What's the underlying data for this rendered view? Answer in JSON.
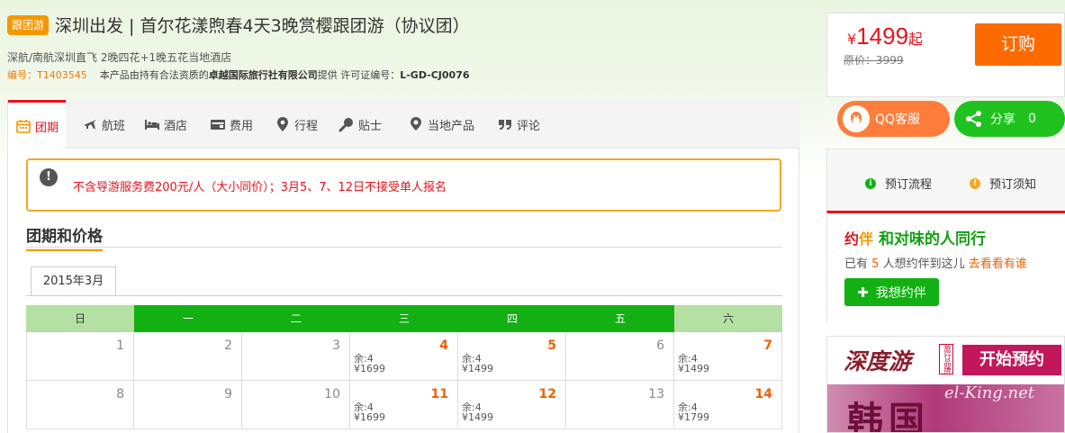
{
  "header": {
    "tag": "跟团游",
    "title": "深圳出发 | 首尔花漾煦春4天3晚赏樱跟团游（协议团）",
    "subtitle": "深航/南航深圳直飞 2晚四花+1晚五花当地酒店",
    "code_label": "编号：",
    "code_value": "T1403545",
    "provider_prefix": "本产品由持有合法资质的",
    "provider_name": "卓越国际旅行社有限公司",
    "provider_suffix": "提供 许可证编号：",
    "license": "L-GD-CJ0076"
  },
  "price": {
    "currency": "¥",
    "amount": "1499",
    "suffix": "起",
    "original": "原价：3999",
    "book_label": "订购"
  },
  "tabs": [
    {
      "label": "团期",
      "icon": "calendar-icon"
    },
    {
      "label": "航班",
      "icon": "plane-icon"
    },
    {
      "label": "酒店",
      "icon": "bed-icon"
    },
    {
      "label": "费用",
      "icon": "wallet-icon"
    },
    {
      "label": "行程",
      "icon": "location-pin-icon"
    },
    {
      "label": "贴士",
      "icon": "magnifier-icon"
    },
    {
      "label": "当地产品",
      "icon": "map-pin-icon"
    },
    {
      "label": "评论",
      "icon": "quote-icon"
    }
  ],
  "notice": {
    "icon": "exclamation-icon",
    "text": "不含导游服务费200元/人（大小同价）；3月5、7、12日不接受单人报名"
  },
  "section_title": "团期和价格",
  "month": "2015年3月",
  "calendar": {
    "weekdays": [
      "日",
      "一",
      "二",
      "三",
      "四",
      "五",
      "六"
    ],
    "rows": [
      [
        {
          "day": "1"
        },
        {
          "day": "2"
        },
        {
          "day": "3"
        },
        {
          "day": "4",
          "remain": "余:4",
          "price": "¥1699"
        },
        {
          "day": "5",
          "remain": "余:4",
          "price": "¥1499"
        },
        {
          "day": "6"
        },
        {
          "day": "7",
          "remain": "余:4",
          "price": "¥1499"
        }
      ],
      [
        {
          "day": "8"
        },
        {
          "day": "9"
        },
        {
          "day": "10"
        },
        {
          "day": "11",
          "remain": "余:4",
          "price": "¥1699"
        },
        {
          "day": "12",
          "remain": "余:4",
          "price": "¥1499"
        },
        {
          "day": "13"
        },
        {
          "day": "14",
          "remain": "余:4",
          "price": "¥1799"
        }
      ]
    ]
  },
  "side": {
    "qq_label": "QQ客服",
    "share_label": "分享",
    "share_count": "0",
    "process_label": "预订流程",
    "notice_label": "预订须知",
    "partner_logo_a": "约",
    "partner_logo_b": "伴",
    "partner_slogan": "和对味的人同行",
    "partner_info_a": "已有",
    "partner_count": "5",
    "partner_info_b": "人想约伴到这儿",
    "partner_link": "去看看有谁",
    "want_label": "我想约伴"
  },
  "ad": {
    "brand": "深度游",
    "seal": "旅行品牌",
    "cta": "开始预约",
    "big": "韩国",
    "watermark": "el-King.net"
  },
  "colors": {
    "accent_orange": "#ff6a00",
    "price_red": "#e8121b",
    "green": "#12b012"
  }
}
